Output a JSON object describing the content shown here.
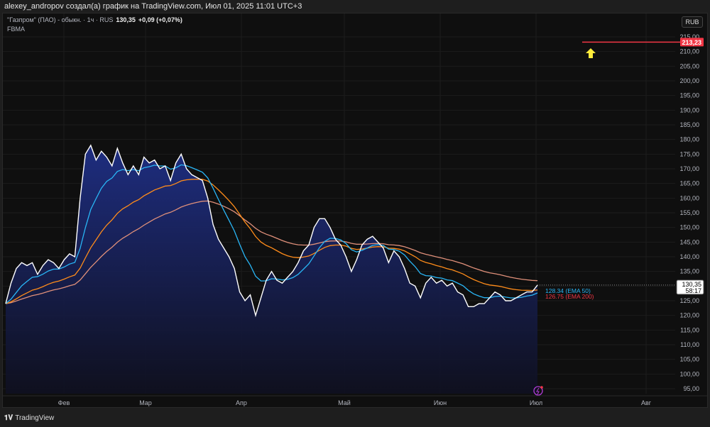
{
  "header": {
    "caption": "alexey_andropov создал(а) график на TradingView.com, Июл 01, 2025 11:01 UTC+3"
  },
  "legend": {
    "symbol": "\"Газпром\" (ПАО) - обыкн. · 1ч · RUS",
    "price": "130,35",
    "change": "+0,09 (+0,07%)",
    "indicator": "FBMA"
  },
  "currency_button": "RUB",
  "footer": {
    "brand": "TradingView",
    "logo": "TV"
  },
  "colors": {
    "price_line": "#ffffff",
    "area_top": "#1f2f86",
    "ema50": "#29b6f6",
    "ema200": "#ff8c1a",
    "alert": "#f23645",
    "arrow": "#ffeb3b"
  },
  "chart_data": {
    "type": "area",
    "title": "\"Газпром\" (ПАО) - обыкн. 1ч",
    "x_ticks": [
      "Фев",
      "Мар",
      "Апр",
      "Май",
      "Июн",
      "Июл",
      "Авг"
    ],
    "y_ticks": [
      "95,00",
      "100,00",
      "105,00",
      "110,00",
      "115,00",
      "120,00",
      "125,00",
      "130,00",
      "135,00",
      "140,00",
      "145,00",
      "150,00",
      "155,00",
      "160,00",
      "165,00",
      "170,00",
      "175,00",
      "180,00",
      "185,00",
      "190,00",
      "195,00",
      "200,00",
      "205,00",
      "210,00",
      "215,00"
    ],
    "ylim": [
      95,
      215
    ],
    "grid": true,
    "values": [
      124,
      131,
      136,
      138,
      137,
      138,
      134,
      137,
      139,
      138,
      136,
      139,
      141,
      140,
      160,
      175,
      178,
      173,
      176,
      174,
      171,
      177,
      172,
      168,
      171,
      168,
      174,
      172,
      173,
      170,
      171,
      166,
      172,
      175,
      170,
      168,
      167,
      166,
      160,
      151,
      146,
      143,
      140,
      136,
      128,
      125,
      127,
      120,
      126,
      132,
      135,
      132,
      131,
      133,
      135,
      138,
      142,
      144,
      150,
      153,
      153,
      150,
      146,
      144,
      140,
      135,
      139,
      144,
      146,
      147,
      145,
      143,
      138,
      142,
      140,
      136,
      131,
      130,
      126,
      131,
      133,
      131,
      132,
      130,
      131,
      128,
      127,
      123,
      123,
      124,
      124,
      126,
      128,
      127,
      125,
      125,
      126,
      127,
      128,
      128,
      130.35
    ],
    "last_price": {
      "value": 130.35,
      "label": "130,35",
      "countdown": "58:17"
    },
    "alert_level": {
      "value": 213.23,
      "label": "213,23"
    },
    "indicators": [
      {
        "name": "EMA 50",
        "value": 128.34,
        "label": "128.34 (EMA 50)"
      },
      {
        "name": "EMA 200",
        "value": 126.75,
        "label": "126.75 (EMA 200)"
      }
    ]
  }
}
